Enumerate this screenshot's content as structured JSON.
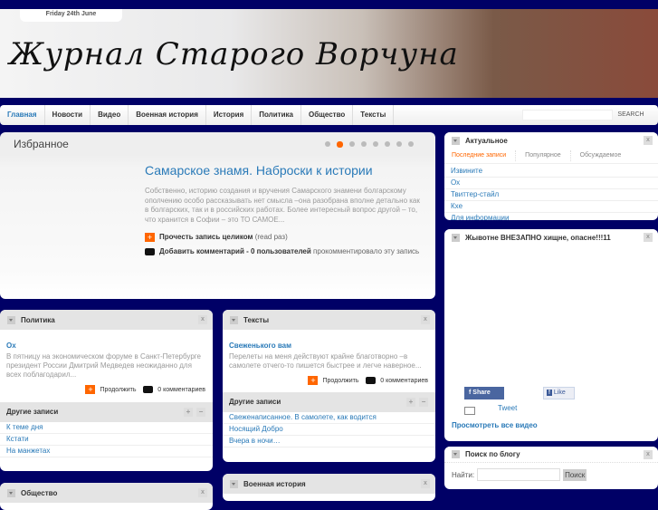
{
  "header": {
    "date": "Friday 24th June",
    "logo": "Журнал Старого Ворчуна"
  },
  "nav": {
    "items": [
      "Главная",
      "Новости",
      "Видео",
      "Военная история",
      "История",
      "Политика",
      "Общество",
      "Тексты"
    ],
    "search_label": "SEARCH"
  },
  "featured": {
    "title": "Избранное",
    "post_title": "Самарское знамя. Наброски к истории",
    "excerpt": "Собственно, историю создания и вручения Самарского знамени болгарскому ополчению особо рассказывать нет смысла  –она разобрана вполне детально как в болгарских, так и в российских работах. Более интересный вопрос другой – то, что хранится в Софии – это ТО САМОЕ...",
    "read_more": "Прочесть запись целиком",
    "read_count": "(read раз)",
    "comment_link": "Добавить комментарий - 0 пользователей",
    "comment_suffix": "прокомментировало эту запись",
    "slides": 8,
    "active_slide": 2
  },
  "politika": {
    "title": "Политика",
    "post_title": "Ох",
    "excerpt": "В пятницу на экономическом форуме в Санкт-Петербурге президент России Дмитрий Медведев неожиданно для всех поблагодарил...",
    "more": "Продолжить",
    "comments": "0 комментариев",
    "other_title": "Другие записи",
    "other": [
      "К теме дня",
      "Кстати",
      "На манжетах"
    ]
  },
  "teksty": {
    "title": "Тексты",
    "post_title": "Свеженького вам",
    "excerpt": "Перелеты на меня действуют крайне благотворно  –в самолете отчего-то пишется быстрее и легче наверное...",
    "more": "Продолжить",
    "comments": "0 комментариев",
    "other_title": "Другие записи",
    "other": [
      "Свеженаписанное. В самолете, как водится",
      "Носящий Добро",
      "Вчера в ночи…"
    ]
  },
  "obshestvo": {
    "title": "Общество"
  },
  "voennaya": {
    "title": "Военная история"
  },
  "aktualnoe": {
    "title": "Актуальное",
    "tabs": [
      "Последние записи",
      "Популярное",
      "Обсуждаемое"
    ],
    "items": [
      "Извините",
      "Ох",
      "Твиттер-стайл",
      "Кхе",
      "Для информации"
    ]
  },
  "video": {
    "title": "Жывотне ВНЕЗАПНО хищне, опасне!!!11",
    "share": "Share",
    "like": "Like",
    "tweet": "Tweet",
    "all": "Просмотреть все видео"
  },
  "blogsearch": {
    "title": "Поиск по блогу",
    "label": "Найти:",
    "button": "Поиск"
  },
  "x": "x",
  "plus": "+",
  "minus": "−"
}
